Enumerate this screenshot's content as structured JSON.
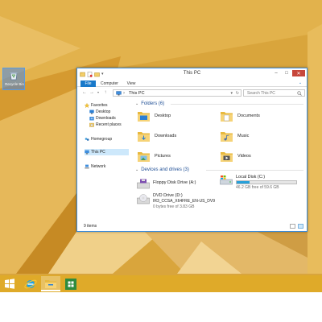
{
  "desktop": {
    "icon_label": "Recycle Bin"
  },
  "window": {
    "title": "This PC",
    "ribbon_tabs": [
      "File",
      "Computer",
      "View"
    ],
    "address": {
      "path": "This PC"
    },
    "search": {
      "placeholder": "Search This PC"
    },
    "nav": {
      "favorites": "Favorites",
      "favorites_items": [
        "Desktop",
        "Downloads",
        "Recent places"
      ],
      "homegroup": "Homegroup",
      "thispc": "This PC",
      "network": "Network"
    },
    "folders_header": "Folders (6)",
    "folders": [
      "Desktop",
      "Documents",
      "Downloads",
      "Music",
      "Pictures",
      "Videos"
    ],
    "devices_header": "Devices and drives (3)",
    "drives": {
      "floppy": {
        "name": "Floppy Disk Drive (A:)"
      },
      "local": {
        "name": "Local Disk (C:)",
        "free": "46.2 GB free of 59.6 GB",
        "used_fraction": 0.22
      },
      "dvd": {
        "name": "DVD Drive (D:)",
        "label": "IR3_CCSA_X64FRE_EN-US_DV9",
        "free": "0 bytes free of 3.83 GB"
      }
    },
    "status": {
      "count": "9 items"
    }
  },
  "colors": {
    "accent": "#1979ca",
    "taskbar": "#e0aa28",
    "wallpaper": "#d8a23a"
  },
  "taskbar": {
    "icons": [
      "start-icon",
      "internet-explorer-icon",
      "file-explorer-icon",
      "store-icon"
    ]
  }
}
